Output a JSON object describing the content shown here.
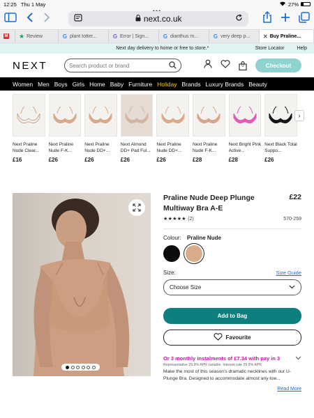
{
  "status": {
    "time": "12:25",
    "date": "Thu 1 May",
    "battery": "27%"
  },
  "browser": {
    "url": "next.co.uk",
    "tabs": [
      {
        "label": "Review",
        "icon": "star-icon"
      },
      {
        "label": "plant totter...",
        "icon": "google-icon"
      },
      {
        "label": "Error | Sign...",
        "icon": "g-icon"
      },
      {
        "label": "dianthus m...",
        "icon": "google-icon"
      },
      {
        "label": "very deep p...",
        "icon": "google-icon"
      },
      {
        "label": "Buy Praline...",
        "icon": "next-icon"
      }
    ]
  },
  "promo": {
    "message": "Next day delivery to home or free to store.*",
    "store_locator": "Store Locator",
    "help": "Help"
  },
  "header": {
    "logo": "NEXT",
    "search_placeholder": "Search product or brand",
    "bag_count": "0",
    "checkout": "Checkout"
  },
  "nav": [
    "Women",
    "Men",
    "Boys",
    "Girls",
    "Home",
    "Baby",
    "Furniture",
    "Holiday",
    "Brands",
    "Luxury Brands",
    "Beauty"
  ],
  "carousel": [
    {
      "name": "Next Praline Nude Clear...",
      "price": "£16",
      "color": "#d9b49a",
      "style": "clear"
    },
    {
      "name": "Next Praline Nude F-K...",
      "price": "£26",
      "color": "#d8a988"
    },
    {
      "name": "Next Praline Nude DD+...",
      "price": "£26",
      "color": "#d8a988"
    },
    {
      "name": "Next Almond DD+ Pad Ful...",
      "price": "£26",
      "color": "#d5b5a2",
      "bg": "#e6dbd2"
    },
    {
      "name": "Next Praline Nude DD+...",
      "price": "£26",
      "color": "#dcaa88"
    },
    {
      "name": "Next Praline Nude F-K...",
      "price": "£28",
      "color": "#d6a58a"
    },
    {
      "name": "Next Bright Pink Active...",
      "price": "£28",
      "color": "#e25ab6"
    },
    {
      "name": "Next Black Total Suppo...",
      "price": "£26",
      "color": "#141414"
    }
  ],
  "product": {
    "title": "Praline Nude Deep Plunge Multiway Bra A-E",
    "price": "£22",
    "rating": 5,
    "review_count": "(2)",
    "code": "570-259",
    "colour_label": "Colour:",
    "colour_value": "Praline Nude",
    "size_label": "Size:",
    "size_guide": "Size Guide",
    "size_placeholder": "Choose Size",
    "add_to_bag": "Add to Bag",
    "favourite": "Favourite",
    "klarna": "Or 3 monthly instalments of £7.34 with pay in 3",
    "representative": "Representative 29.9% APR variable. Interest rate 29.9% APR",
    "description": "Make the most of this season's dramatic necklines with our U-Plunge Bra. Designed to accommodate almost any low...",
    "read_more": "Read More",
    "image_count": 6,
    "image_active": 1
  }
}
